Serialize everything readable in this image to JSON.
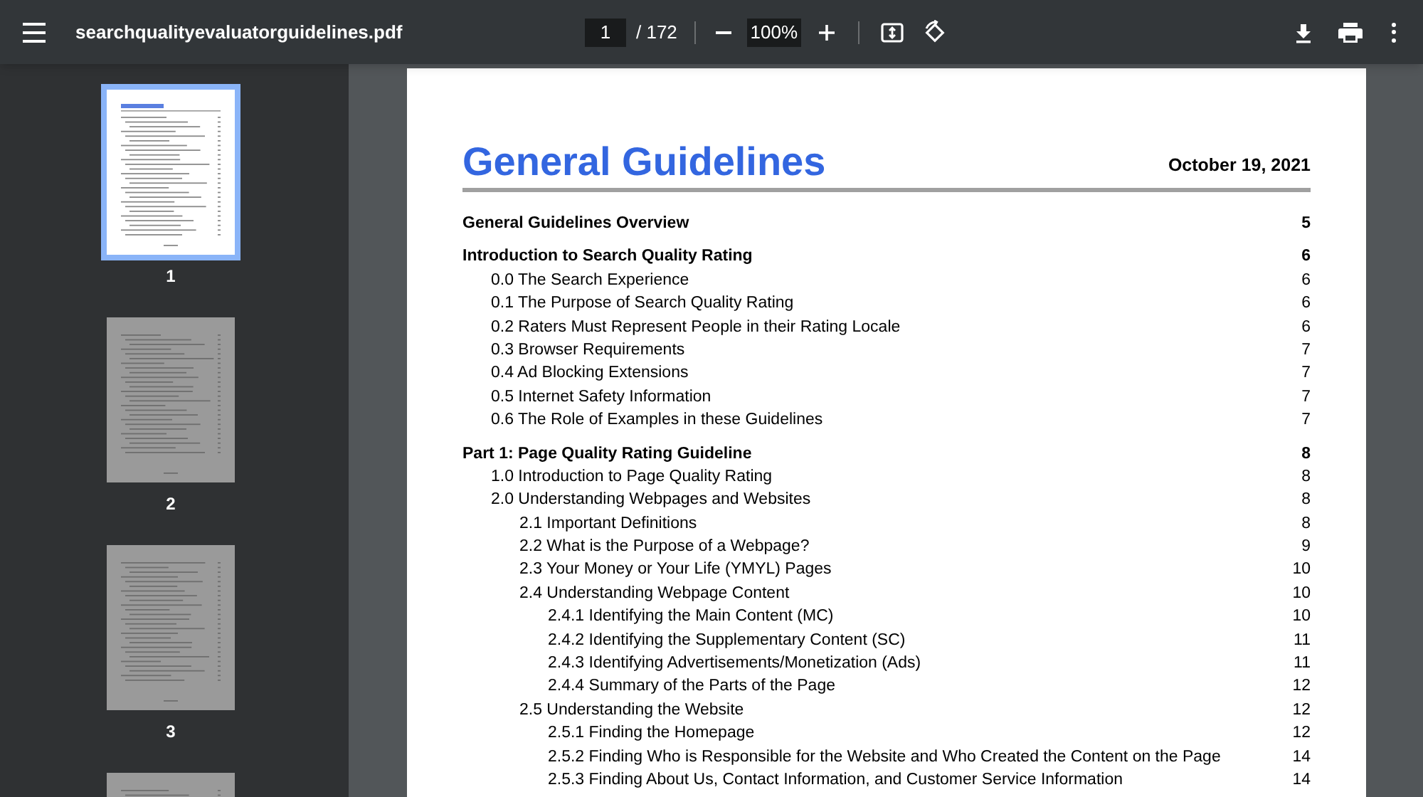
{
  "toolbar": {
    "title": "searchqualityevaluatorguidelines.pdf",
    "page_input": "1",
    "page_total": "/ 172",
    "zoom": "100%"
  },
  "thumbnails": [
    {
      "label": "1",
      "selected": true
    },
    {
      "label": "2",
      "selected": false
    },
    {
      "label": "3",
      "selected": false
    },
    {
      "selected": false
    }
  ],
  "document": {
    "heading": "General Guidelines",
    "date": "October 19, 2021",
    "toc": [
      {
        "title": "General Guidelines Overview",
        "page": "5"
      },
      {
        "title": "Introduction to Search Quality Rating",
        "page": "6",
        "children": [
          {
            "title": "0.0 The Search Experience",
            "page": "6"
          },
          {
            "title": "0.1 The Purpose of Search Quality Rating",
            "page": "6"
          },
          {
            "title": "0.2 Raters Must Represent People in their Rating Locale",
            "page": "6"
          },
          {
            "title": "0.3 Browser Requirements",
            "page": "7"
          },
          {
            "title": "0.4 Ad Blocking Extensions",
            "page": "7"
          },
          {
            "title": "0.5 Internet Safety Information",
            "page": "7"
          },
          {
            "title": "0.6 The Role of Examples in these Guidelines",
            "page": "7"
          }
        ]
      },
      {
        "title": "Part 1: Page Quality Rating Guideline",
        "page": "8",
        "children": [
          {
            "title": "1.0 Introduction to Page Quality Rating",
            "page": "8"
          },
          {
            "title": "2.0 Understanding Webpages and Websites",
            "page": "8",
            "children": [
              {
                "title": "2.1 Important Definitions",
                "page": "8"
              },
              {
                "title": "2.2 What is the Purpose of a Webpage?",
                "page": "9"
              },
              {
                "title": "2.3 Your Money or Your Life (YMYL) Pages",
                "page": "10"
              },
              {
                "title": "2.4 Understanding Webpage Content",
                "page": "10",
                "children": [
                  {
                    "title": "2.4.1 Identifying the Main Content (MC)",
                    "page": "10"
                  },
                  {
                    "title": "2.4.2 Identifying the Supplementary Content (SC)",
                    "page": "11"
                  },
                  {
                    "title": "2.4.3 Identifying Advertisements/Monetization (Ads)",
                    "page": "11"
                  },
                  {
                    "title": "2.4.4 Summary of the Parts of the Page",
                    "page": "12"
                  }
                ]
              },
              {
                "title": "2.5 Understanding the Website",
                "page": "12",
                "children": [
                  {
                    "title": "2.5.1 Finding the Homepage",
                    "page": "12"
                  },
                  {
                    "title": "2.5.2 Finding Who is Responsible for the Website and Who Created the Content on the Page",
                    "page": "14"
                  },
                  {
                    "title": "2.5.3 Finding About Us, Contact Information, and Customer Service Information",
                    "page": "14"
                  }
                ]
              }
            ]
          }
        ]
      }
    ]
  }
}
